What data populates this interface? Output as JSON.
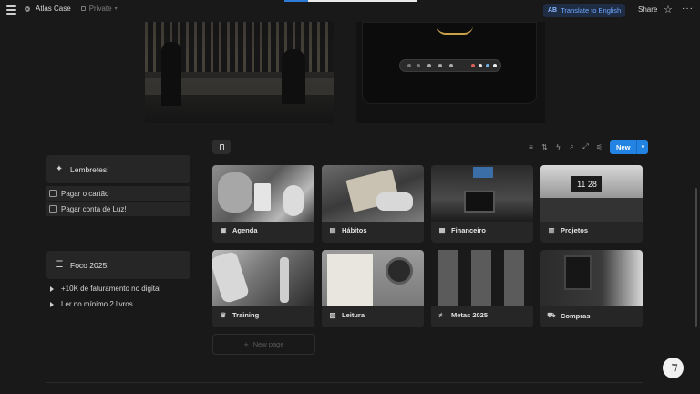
{
  "topbar": {
    "workspace_title": "Atlas Case",
    "visibility": "Private",
    "translate_badge": "AB",
    "translate_label": "Translate to English",
    "share_label": "Share",
    "star_glyph": "☆",
    "more_glyph": "···"
  },
  "reminders": {
    "title": "Lembretes!",
    "icon": "sparkle-icon",
    "items": [
      {
        "label": "Pagar o cartão",
        "checked": false
      },
      {
        "label": "Pagar conta de Luz!",
        "checked": false
      }
    ]
  },
  "focus": {
    "title": "Foco 2025!",
    "icon": "checklist-icon",
    "items": [
      {
        "label": "+10K de faturamento no digital"
      },
      {
        "label": "Ler no mínimo 2 livros"
      }
    ]
  },
  "database": {
    "new_label": "New",
    "tools": [
      "filter-icon",
      "sort-icon",
      "lightning-icon",
      "search-icon",
      "expand-icon",
      "settings-icon"
    ],
    "cards": [
      {
        "label": "Agenda",
        "icon": "calendar-icon"
      },
      {
        "label": "Hábitos",
        "icon": "book-icon"
      },
      {
        "label": "Financeiro",
        "icon": "wallet-icon"
      },
      {
        "label": "Projetos",
        "icon": "chart-icon"
      },
      {
        "label": "Training",
        "icon": "trophy-icon"
      },
      {
        "label": "Leitura",
        "icon": "document-icon"
      },
      {
        "label": "Metas 2025",
        "icon": "goals-icon"
      },
      {
        "label": "Compras",
        "icon": "cart-icon"
      }
    ],
    "new_page_label": "New page"
  },
  "colors": {
    "accent": "#2383e2",
    "background": "#191919",
    "panel": "#262626"
  }
}
